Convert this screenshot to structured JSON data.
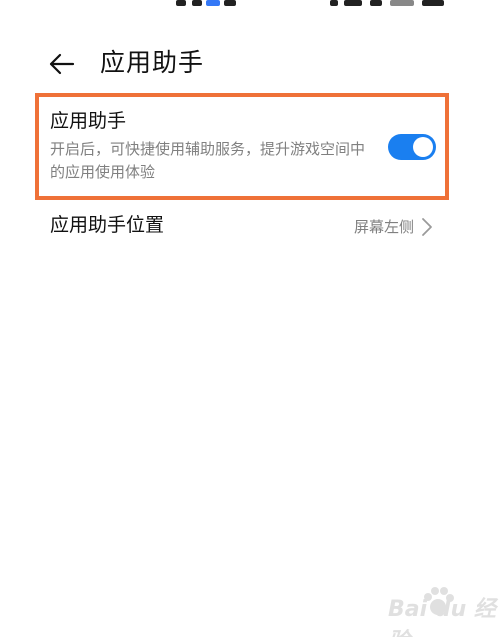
{
  "header": {
    "back_icon": "arrow-left-icon",
    "title": "应用助手"
  },
  "settings": {
    "assistant": {
      "title": "应用助手",
      "description": "开启后，可快捷使用辅助服务，提升游戏空间中的应用使用体验",
      "enabled": true
    },
    "position": {
      "title": "应用助手位置",
      "value": "屏幕左侧",
      "chevron_icon": "chevron-right-icon"
    }
  },
  "colors": {
    "accent": "#1a7ff0",
    "highlight": "#ef7138",
    "secondary_text": "#808080"
  },
  "watermark": {
    "text": "Bai du 经验",
    "icon": "baidu-paw-icon"
  }
}
